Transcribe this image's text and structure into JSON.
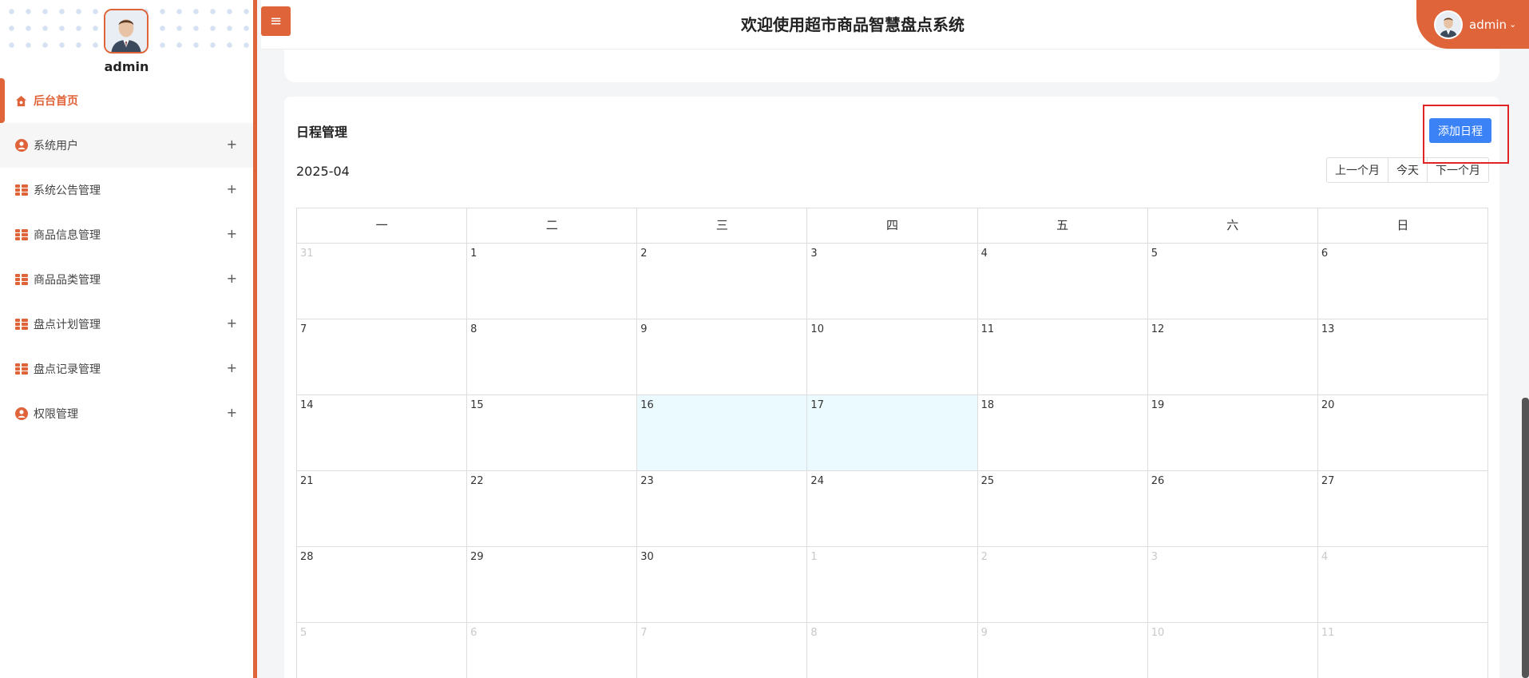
{
  "header": {
    "title": "欢迎使用超市商品智慧盘点系统",
    "user_name": "admin",
    "toggle_glyph": "≡"
  },
  "sidebar": {
    "user_name": "admin",
    "items": [
      {
        "label": "后台首页",
        "icon": "home-icon",
        "active": true
      },
      {
        "label": "系统用户",
        "icon": "user-circle-icon"
      },
      {
        "label": "系统公告管理",
        "icon": "grid-icon"
      },
      {
        "label": "商品信息管理",
        "icon": "grid-icon"
      },
      {
        "label": "商品品类管理",
        "icon": "grid-icon"
      },
      {
        "label": "盘点计划管理",
        "icon": "grid-icon"
      },
      {
        "label": "盘点记录管理",
        "icon": "grid-icon"
      },
      {
        "label": "权限管理",
        "icon": "user-circle-icon"
      }
    ],
    "expand_glyph": "+"
  },
  "schedule": {
    "title": "日程管理",
    "add_button": "添加日程",
    "month": "2025-04",
    "prev_month": "上一个月",
    "today": "今天",
    "next_month": "下一个月",
    "weekdays": [
      "一",
      "二",
      "三",
      "四",
      "五",
      "六",
      "日"
    ],
    "weeks": [
      [
        "31",
        "1",
        "2",
        "3",
        "4",
        "5",
        "6"
      ],
      [
        "7",
        "8",
        "9",
        "10",
        "11",
        "12",
        "13"
      ],
      [
        "14",
        "15",
        "16",
        "17",
        "18",
        "19",
        "20"
      ],
      [
        "21",
        "22",
        "23",
        "24",
        "25",
        "26",
        "27"
      ],
      [
        "28",
        "29",
        "30",
        "1",
        "2",
        "3",
        "4"
      ],
      [
        "5",
        "6",
        "7",
        "8",
        "9",
        "10",
        "11"
      ]
    ]
  },
  "colors": {
    "accent": "#e0643a",
    "primary_button": "#3b82f6",
    "highlight_box": "#e02424",
    "today_bg": "#eafaff"
  }
}
